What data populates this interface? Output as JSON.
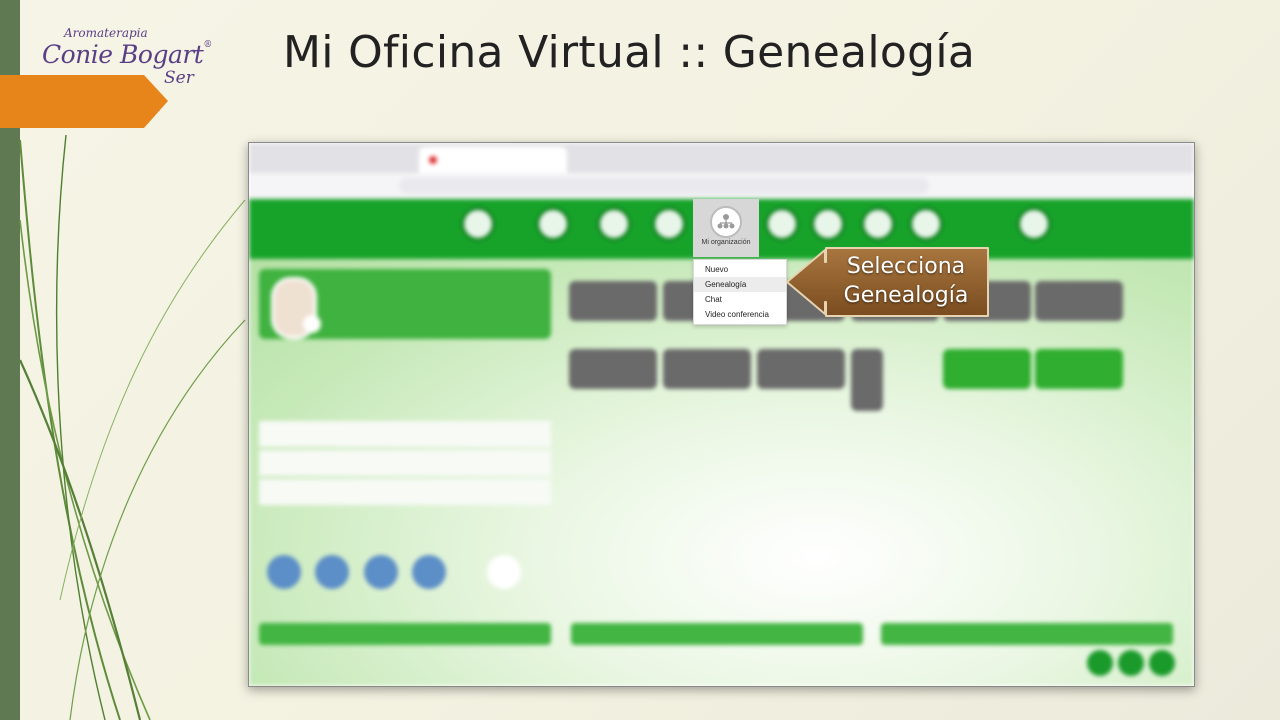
{
  "slide": {
    "title": "Mi Oficina Virtual :: Genealogía",
    "logo": {
      "line1": "Aromaterapia",
      "line2": "Conie Bogart",
      "registered": "®",
      "line3": "Ser"
    }
  },
  "colors": {
    "accent_orange": "#e8851a",
    "brand_purple": "#5a3f86",
    "left_band": "#5f7a52",
    "nav_green": "#17a32a",
    "callout_brown": "#8a5a28"
  },
  "menu": {
    "active_item": {
      "label": "Mi organización",
      "icon": "organization-icon"
    },
    "dropdown": [
      {
        "label": "Nuevo",
        "highlighted": false
      },
      {
        "label": "Genealogía",
        "highlighted": true
      },
      {
        "label": "Chat",
        "highlighted": false
      },
      {
        "label": "Video conferencia",
        "highlighted": false
      }
    ]
  },
  "callout": {
    "line1": "Selecciona",
    "line2": "Genealogía"
  }
}
